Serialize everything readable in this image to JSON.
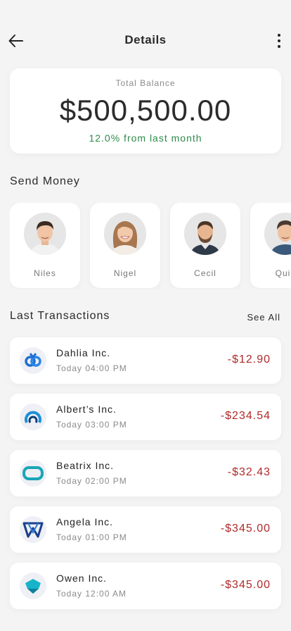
{
  "header": {
    "title": "Details",
    "back_icon": "arrow-left-icon",
    "more_icon": "more-vertical-icon"
  },
  "balance": {
    "label": "Total Balance",
    "amount": "$500,500.00",
    "change": "12.0% from last month"
  },
  "send_money": {
    "title": "Send Money",
    "contacts": [
      {
        "name": "Niles"
      },
      {
        "name": "Nigel"
      },
      {
        "name": "Cecil"
      },
      {
        "name": "Quic"
      }
    ]
  },
  "transactions": {
    "title": "Last Transactions",
    "see_all": "See All",
    "items": [
      {
        "name": "Dahlia Inc.",
        "time": "Today 04:00 PM",
        "amount": "-$12.90",
        "icon": "dahlia-logo-icon"
      },
      {
        "name": "Albert’s Inc.",
        "time": "Today 03:00 PM",
        "amount": "-$234.54",
        "icon": "alberts-logo-icon"
      },
      {
        "name": "Beatrix Inc.",
        "time": "Today 02:00 PM",
        "amount": "-$32.43",
        "icon": "beatrix-logo-icon"
      },
      {
        "name": "Angela Inc.",
        "time": "Today 01:00 PM",
        "amount": "-$345.00",
        "icon": "angela-logo-icon"
      },
      {
        "name": "Owen Inc.",
        "time": "Today 12:00 AM",
        "amount": "-$345.00",
        "icon": "owen-logo-icon"
      }
    ]
  },
  "colors": {
    "positive": "#2e8b4a",
    "negative": "#b02a2a",
    "background": "#f4f4f4"
  }
}
